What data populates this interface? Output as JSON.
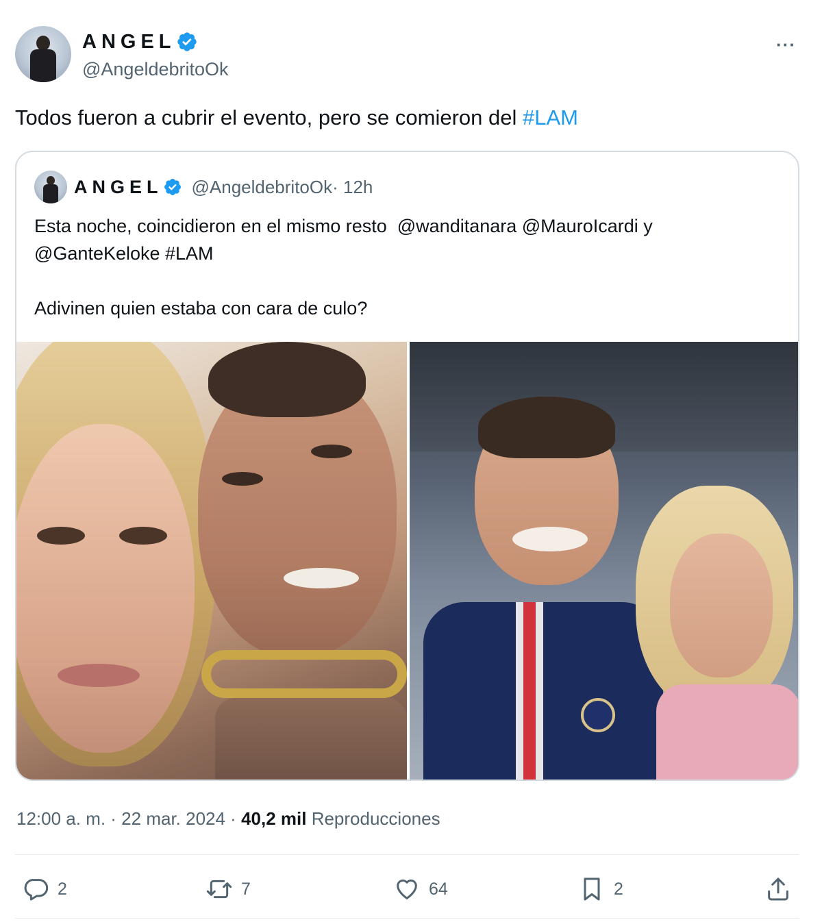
{
  "author": {
    "name": "ANGEL",
    "handle": "@AngeldebritoOk"
  },
  "tweet": {
    "text_main": "Todos fueron a cubrir el evento, pero se comieron del ",
    "hashtag": "#LAM"
  },
  "quoted": {
    "name": "ANGEL",
    "handle": "@AngeldebritoOk",
    "time": " · 12h",
    "line1": "Esta noche, coincidieron en el mismo resto  @wanditanara @MauroIcardi y",
    "line2": "@GanteKeloke #LAM",
    "line3": "Adivinen quien estaba con cara de culo?"
  },
  "meta": {
    "time": "12:00 a. m.",
    "date": " · 22 mar. 2024 · ",
    "views_count": "40,2 mil",
    "views_label": " Reproducciones"
  },
  "actions": {
    "replies": "2",
    "reposts": "7",
    "likes": "64",
    "bookmarks": "2"
  },
  "more_label": "···",
  "colors": {
    "accent": "#1d9bf0",
    "text": "#0f1419",
    "secondary": "#536471"
  }
}
